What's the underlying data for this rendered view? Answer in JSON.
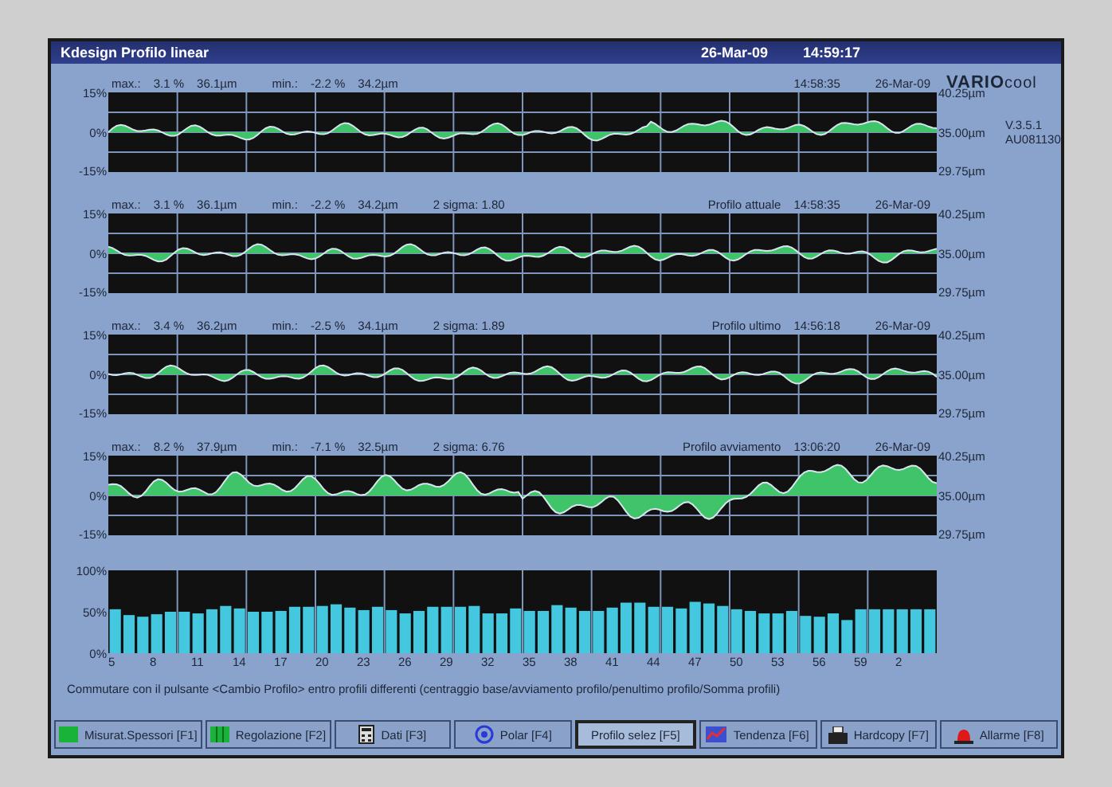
{
  "title_bar": {
    "title": "Kdesign Profilo linear",
    "date": "26-Mar-09",
    "time": "14:59:17"
  },
  "brand": {
    "logo_main": "VARIO",
    "logo_sub": "cool",
    "version": "V.3.5.1",
    "serial": "AU081130"
  },
  "profiles": [
    {
      "stats": [
        "max.:",
        "3.1 %",
        "36.1µm",
        "min.:",
        "-2.2 %",
        "34.2µm"
      ],
      "time": "14:58:35",
      "date": "26-Mar-09",
      "left_axis": [
        "15%",
        "0%",
        "-15%"
      ],
      "right_axis": [
        "40.25µm",
        "35.00µm",
        "29.75µm"
      ]
    },
    {
      "stats": [
        "max.:",
        "3.1 %",
        "36.1µm",
        "min.:",
        "-2.2 %",
        "34.2µm"
      ],
      "sigma": "2 sigma: 1.80",
      "label": "Profilo attuale",
      "time": "14:58:35",
      "date": "26-Mar-09",
      "left_axis": [
        "15%",
        "0%",
        "-15%"
      ],
      "right_axis": [
        "40.25µm",
        "35.00µm",
        "29.75µm"
      ]
    },
    {
      "stats": [
        "max.:",
        "3.4 %",
        "36.2µm",
        "min.:",
        "-2.5 %",
        "34.1µm"
      ],
      "sigma": "2 sigma: 1.89",
      "label": "Profilo ultimo",
      "time": "14:56:18",
      "date": "26-Mar-09",
      "left_axis": [
        "15%",
        "0%",
        "-15%"
      ],
      "right_axis": [
        "40.25µm",
        "35.00µm",
        "29.75µm"
      ]
    },
    {
      "stats": [
        "max.:",
        "8.2 %",
        "37.9µm",
        "min.:",
        "-7.1 %",
        "32.5µm"
      ],
      "sigma": "2 sigma: 6.76",
      "label": "Profilo avviamento",
      "time": "13:06:20",
      "date": "26-Mar-09",
      "left_axis": [
        "15%",
        "0%",
        "-15%"
      ],
      "right_axis": [
        "40.25µm",
        "35.00µm",
        "29.75µm"
      ]
    }
  ],
  "bar_chart": {
    "chart_data": {
      "type": "bar",
      "categories": [
        "5",
        null,
        null,
        "8",
        null,
        null,
        "11",
        null,
        null,
        "14",
        null,
        null,
        "17",
        null,
        null,
        "20",
        null,
        null,
        "23",
        null,
        null,
        "26",
        null,
        null,
        "29",
        null,
        null,
        "32",
        null,
        null,
        "35",
        null,
        null,
        "38",
        null,
        null,
        "41",
        null,
        null,
        "44",
        null,
        null,
        "47",
        null,
        null,
        "50",
        null,
        null,
        "53",
        null,
        null,
        "56",
        null,
        null,
        "59",
        null,
        null,
        "2",
        null,
        null
      ],
      "values": [
        53,
        46,
        44,
        47,
        50,
        50,
        48,
        53,
        57,
        54,
        50,
        50,
        51,
        56,
        56,
        57,
        59,
        55,
        52,
        56,
        52,
        48,
        51,
        56,
        56,
        56,
        57,
        48,
        48,
        54,
        51,
        51,
        58,
        55,
        51,
        51,
        55,
        61,
        61,
        56,
        56,
        54,
        62,
        60,
        57,
        53,
        51,
        48,
        48,
        51,
        45,
        44,
        48,
        40,
        53,
        53,
        53,
        53,
        53,
        53
      ],
      "ylim": [
        0,
        100
      ],
      "yticks": [
        {
          "value": 100,
          "label": "100%"
        },
        {
          "value": 50,
          "label": "50%"
        },
        {
          "value": 0,
          "label": "0%"
        }
      ]
    }
  },
  "hint": "Commutare con il pulsante <Cambio Profilo> entro profili differenti (centraggio base/avviamento profilo/penultimo profilo/Somma profili)",
  "function_keys": [
    {
      "label": "Misurat.Spessori [F1]",
      "kind": "square",
      "selected": false
    },
    {
      "label": "Regolazione [F2]",
      "kind": "grid",
      "selected": false
    },
    {
      "label": "Dati [F3]",
      "kind": "calculator",
      "selected": false
    },
    {
      "label": "Polar [F4]",
      "kind": "target",
      "selected": false
    },
    {
      "label": "Profilo selez [F5]",
      "kind": "plain",
      "selected": true
    },
    {
      "label": "Tendenza [F6]",
      "kind": "trend",
      "selected": false
    },
    {
      "label": "Hardcopy [F7]",
      "kind": "printer",
      "selected": false
    },
    {
      "label": "Allarme [F8]",
      "kind": "alarm",
      "selected": false
    }
  ]
}
